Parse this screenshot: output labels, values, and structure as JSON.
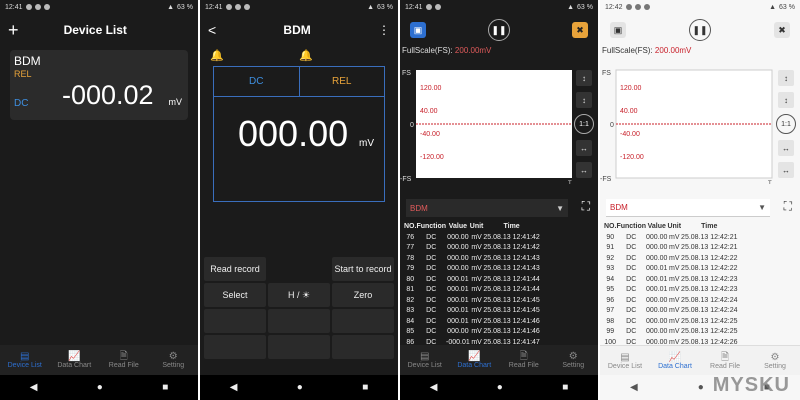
{
  "status": {
    "s1": {
      "time": "12:41",
      "battery": "63 %"
    },
    "s2": {
      "time": "12:41",
      "battery": "63 %"
    },
    "s3": {
      "time": "12:41",
      "battery": "63 %"
    },
    "s4": {
      "time": "12:42",
      "battery": "63 %"
    }
  },
  "screen1": {
    "title": "Device List",
    "add_icon": "+",
    "card": {
      "name": "BDM",
      "mode": "REL",
      "func": "DC",
      "value": "-000.02",
      "unit": "mV"
    }
  },
  "screen2": {
    "title": "BDM",
    "back_icon": "<",
    "menu_icon": "⋮",
    "left_icon": "🔔",
    "right_icon": "🔔",
    "func": "DC",
    "mode": "REL",
    "value": "000.00",
    "unit": "mV",
    "buttons": [
      "Read record",
      "",
      "Start to record",
      "Select",
      "H / ☀",
      "Zero"
    ]
  },
  "tabs": [
    {
      "label": "Device List",
      "icon": "▤"
    },
    {
      "label": "Data Chart",
      "icon": "📈"
    },
    {
      "label": "Read File",
      "icon": "🗎"
    },
    {
      "label": "Setting",
      "icon": "⚙"
    }
  ],
  "nav": {
    "back": "◀",
    "home": "●",
    "recent": "■"
  },
  "chart": {
    "fullscale": "FullScale(FS):",
    "fs_value": "200.00mV",
    "ylabels": [
      "FS",
      "0",
      "-FS"
    ],
    "tlabel": "T",
    "levels": [
      "120.00",
      "40.00",
      "-40.00",
      "-120.00"
    ],
    "side": [
      "↕",
      "↕",
      "1:1",
      "↔",
      "↔"
    ],
    "device": "BDM",
    "expand_icon": "⛶"
  },
  "table_headers": [
    "NO.",
    "Function",
    "Value",
    "Unit",
    "Time"
  ],
  "table3": [
    [
      "76",
      "DC",
      "000.00",
      "mV",
      "25.08.13 12:41:42"
    ],
    [
      "77",
      "DC",
      "000.00",
      "mV",
      "25.08.13 12:41:42"
    ],
    [
      "78",
      "DC",
      "000.00",
      "mV",
      "25.08.13 12:41:43"
    ],
    [
      "79",
      "DC",
      "000.00",
      "mV",
      "25.08.13 12:41:43"
    ],
    [
      "80",
      "DC",
      "000.01",
      "mV",
      "25.08.13 12:41:44"
    ],
    [
      "81",
      "DC",
      "000.01",
      "mV",
      "25.08.13 12:41:44"
    ],
    [
      "82",
      "DC",
      "000.01",
      "mV",
      "25.08.13 12:41:45"
    ],
    [
      "83",
      "DC",
      "000.01",
      "mV",
      "25.08.13 12:41:45"
    ],
    [
      "84",
      "DC",
      "000.01",
      "mV",
      "25.08.13 12:41:46"
    ],
    [
      "85",
      "DC",
      "000.00",
      "mV",
      "25.08.13 12:41:46"
    ],
    [
      "86",
      "DC",
      "-000.01",
      "mV",
      "25.08.13 12:41:47"
    ]
  ],
  "table4": [
    [
      "90",
      "DC",
      "000.00",
      "mV",
      "25.08.13 12:42:21"
    ],
    [
      "91",
      "DC",
      "000.00",
      "mV",
      "25.08.13 12:42:21"
    ],
    [
      "92",
      "DC",
      "000.00",
      "mV",
      "25.08.13 12:42:22"
    ],
    [
      "93",
      "DC",
      "000.01",
      "mV",
      "25.08.13 12:42:22"
    ],
    [
      "94",
      "DC",
      "000.01",
      "mV",
      "25.08.13 12:42:23"
    ],
    [
      "95",
      "DC",
      "000.01",
      "mV",
      "25.08.13 12:42:23"
    ],
    [
      "96",
      "DC",
      "000.00",
      "mV",
      "25.08.13 12:42:24"
    ],
    [
      "97",
      "DC",
      "000.00",
      "mV",
      "25.08.13 12:42:24"
    ],
    [
      "98",
      "DC",
      "000.00",
      "mV",
      "25.08.13 12:42:25"
    ],
    [
      "99",
      "DC",
      "000.00",
      "mV",
      "25.08.13 12:42:25"
    ],
    [
      "100",
      "DC",
      "000.00",
      "mV",
      "25.08.13 12:42:26"
    ]
  ],
  "watermark": "MYSKU",
  "colors": {
    "accent": "#2d6fd0",
    "orange": "#e8a33a",
    "red": "#c8202a"
  }
}
